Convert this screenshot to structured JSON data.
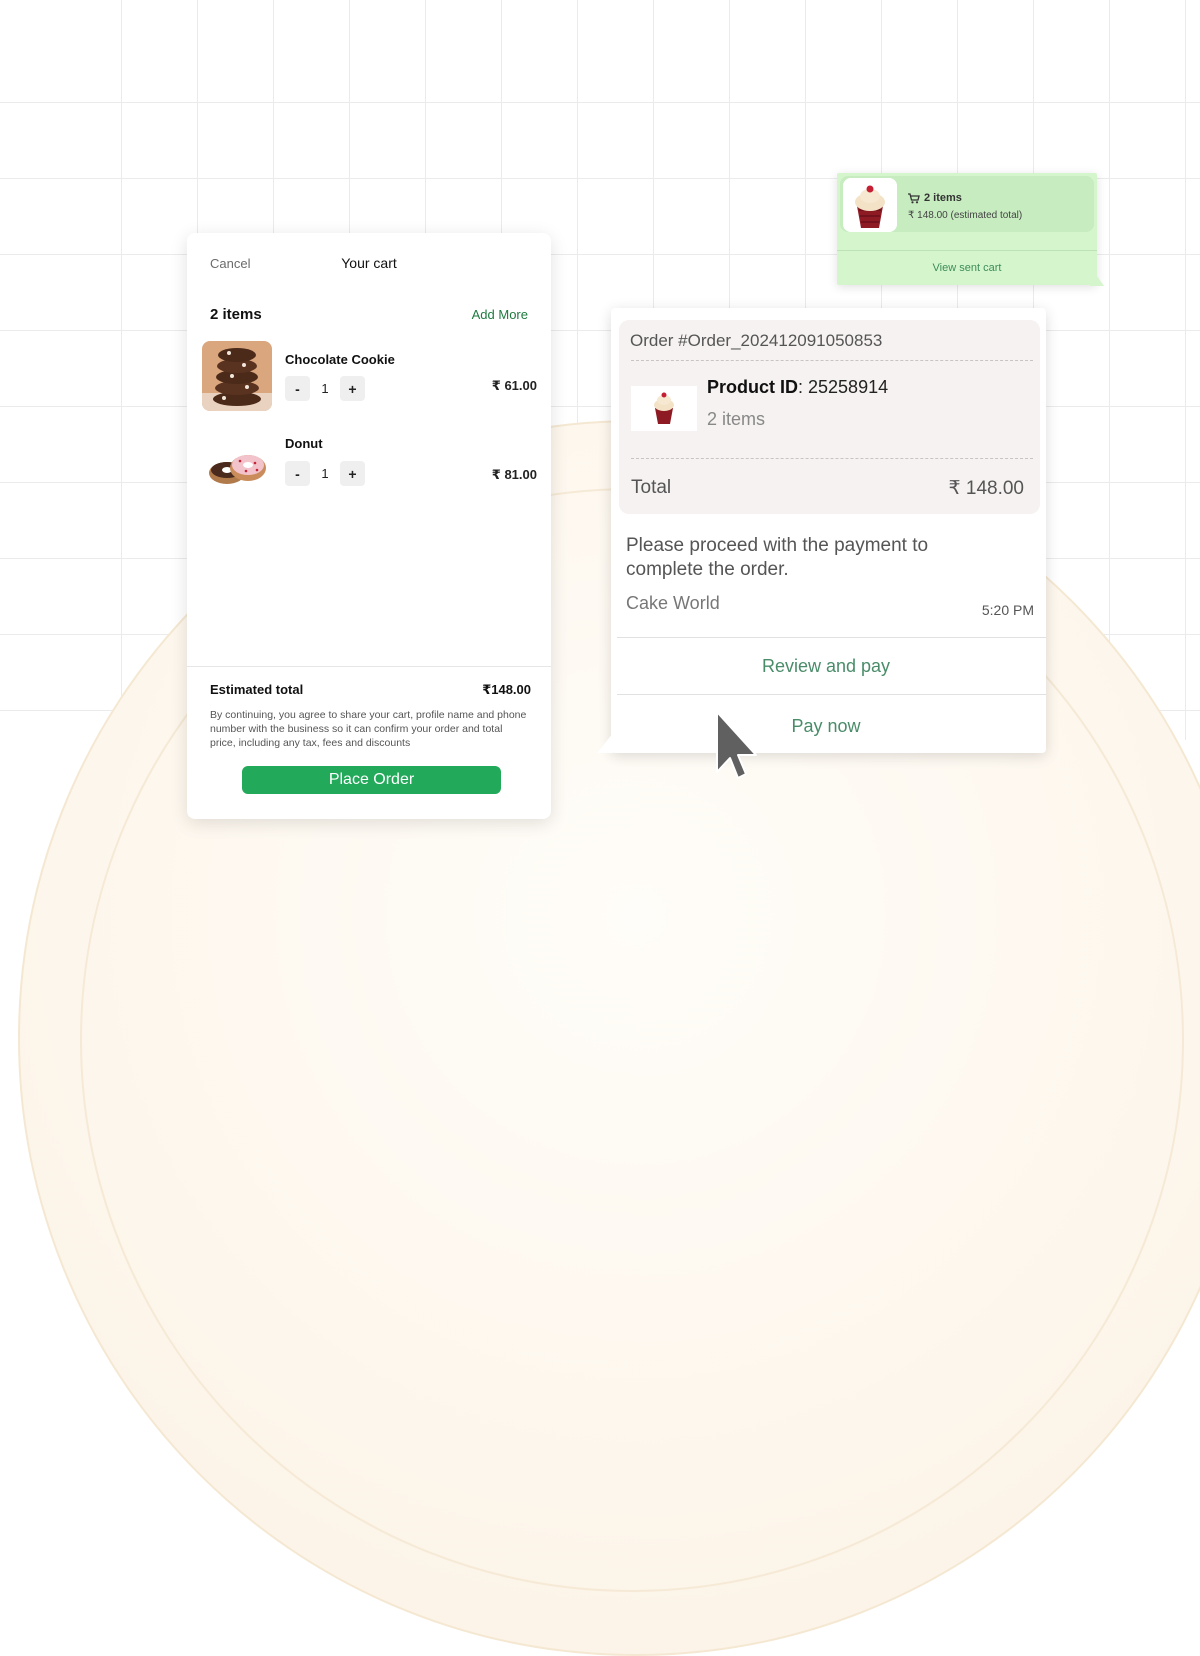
{
  "cart": {
    "cancel_label": "Cancel",
    "title": "Your cart",
    "item_count": "2 items",
    "add_more_label": "Add More",
    "items": [
      {
        "name": "Chocolate Cookie",
        "qty": "1",
        "price": "₹ 61.00",
        "minus": "-",
        "plus": "+"
      },
      {
        "name": "Donut",
        "qty": "1",
        "price": "₹ 81.00",
        "minus": "-",
        "plus": "+"
      }
    ],
    "estimated_label": "Estimated total",
    "estimated_value": "₹148.00",
    "terms": "By continuing, you agree to share your cart, profile name and phone number with the business so it can confirm your order and total price, including any tax, fees and discounts",
    "place_order_label": "Place Order"
  },
  "sent_cart": {
    "items": "2 items",
    "total": "₹ 148.00 (estimated total)",
    "view_label": "View sent cart",
    "icon": "cart-icon"
  },
  "order": {
    "order_id": "Order #Order_202412091050853",
    "product_id_label": "Product ID",
    "product_id_value": ": 25258914",
    "items": "2 items",
    "total_label": "Total",
    "total_value": "₹ 148.00",
    "message": "Please proceed with the payment to complete the order.",
    "business": "Cake World",
    "time": "5:20 PM",
    "review_label": "Review and pay",
    "pay_label": "Pay now"
  },
  "colors": {
    "brand_green": "#22a95a",
    "link_green": "#4a8c69",
    "bubble_green": "#d5f6cd"
  }
}
